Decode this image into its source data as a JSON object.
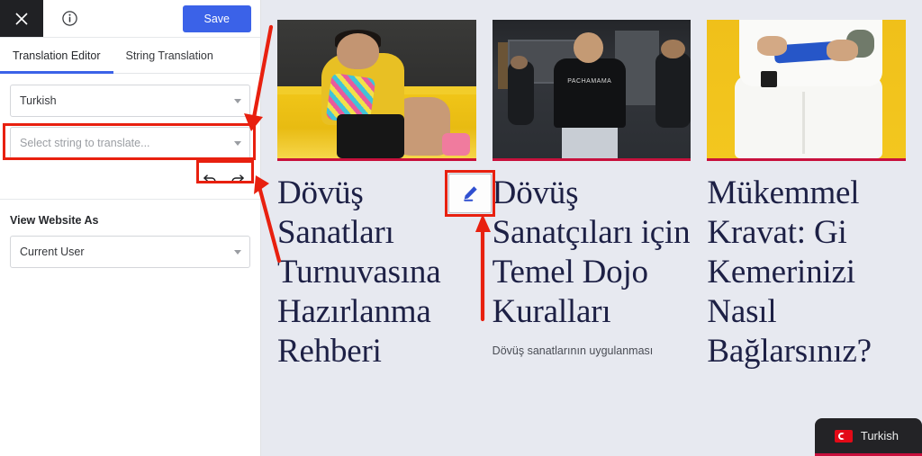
{
  "sidebar": {
    "close_icon": "close-icon",
    "info_icon": "info-icon",
    "save_label": "Save",
    "tabs": [
      {
        "label": "Translation Editor",
        "active": true
      },
      {
        "label": "String Translation",
        "active": false
      }
    ],
    "language_select": {
      "value": "Turkish",
      "caret_icon": "chevron-down-icon"
    },
    "string_select": {
      "placeholder": "Select string to translate...",
      "value": "",
      "caret_icon": "chevron-down-icon"
    },
    "undo_icon": "undo-arrow-icon",
    "redo_icon": "redo-arrow-icon",
    "view_website_as_label": "View Website As",
    "view_as_select": {
      "value": "Current User",
      "caret_icon": "chevron-down-icon"
    }
  },
  "main": {
    "edit_button_icon": "pencil-edit-icon",
    "cards": [
      {
        "image_alt": "fighter-in-yellow-shirt-wrapping-hands-in-ring",
        "title": "Dövüş Sanatları Turnuvasına Hazırlanma Rehberi",
        "excerpt": ""
      },
      {
        "image_alt": "smiling-man-in-black-pachamama-tshirt-in-gym",
        "image_text": "PACHAMAMA",
        "title": "Dövüş Sanatçıları için Temel Dojo Kuralları",
        "excerpt": "Dövüş sanatlarının uygulanması"
      },
      {
        "image_alt": "person-in-white-gi-tying-blue-belt-on-yellow-mat",
        "title": "Mükemmel Kravat: Gi Kemerinizi Nasıl Bağlarsınız?",
        "excerpt": ""
      }
    ],
    "language_switcher": {
      "label": "Turkish",
      "flag_icon": "turkish-flag-icon"
    }
  },
  "annotations": {
    "highlight_color": "#e8200f",
    "arrow_color": "#e8200f"
  },
  "colors": {
    "accent_blue": "#3b62e8",
    "content_bg": "#e7e9f0",
    "title_navy": "#1d2045",
    "card_underline": "#c8103c",
    "flag_red": "#e30a17"
  }
}
